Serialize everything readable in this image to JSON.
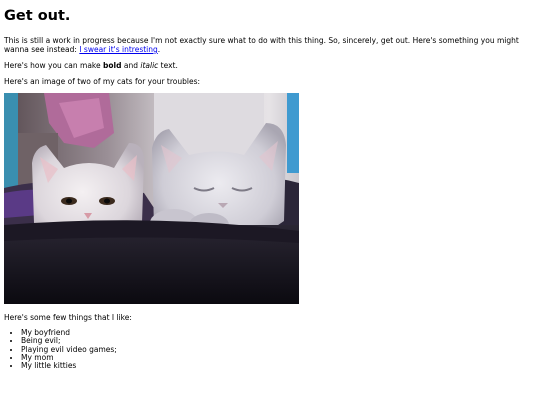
{
  "page": {
    "title": "Get out.",
    "intro": {
      "text": "This is still a work in progress because I'm not exactly sure what to do with this thing. So, sincerely, get out. Here's something you might wanna see instead: ",
      "link_label": "I swear it's intresting",
      "after_link": "."
    },
    "formatting": {
      "before": "Here's how you can make ",
      "bold": "bold",
      "middle": " and ",
      "italic": "italic",
      "after": " text."
    },
    "image_caption": "Here's an image of two of my cats for your troubles:",
    "likes_intro": "Here's some few things that I like:",
    "likes": [
      "My boyfriend",
      "Being evil;",
      "Playing evil video games;",
      "My mom",
      "My little kitties"
    ]
  },
  "colors": {
    "link": "#0000ee",
    "text": "#000000",
    "background": "#ffffff"
  }
}
